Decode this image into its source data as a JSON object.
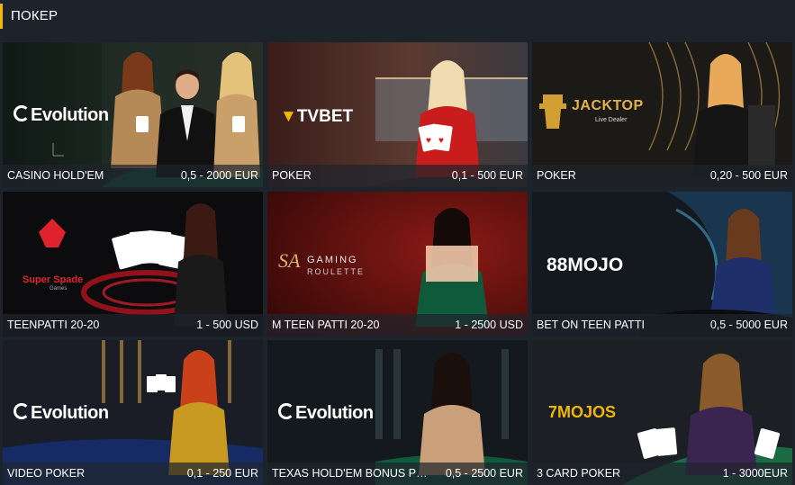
{
  "section": {
    "title": "ПОКЕР"
  },
  "colors": {
    "accent": "#f2b705",
    "background": "#1c232b"
  },
  "cards": [
    {
      "name": "CASINO HOLD'EM",
      "limits": "0,5 - 2000 EUR",
      "provider": "Evolution"
    },
    {
      "name": "POKER",
      "limits": "0,1 - 500 EUR",
      "provider": "TVBET"
    },
    {
      "name": "POKER",
      "limits": "0,20 - 500 EUR",
      "provider": "JACKTOP",
      "provider_sub": "Live Dealer"
    },
    {
      "name": "TEENPATTI 20-20",
      "limits": "1 - 500 USD",
      "provider": "Super Spade",
      "provider_sub": "Games"
    },
    {
      "name": "M TEEN PATTI 20-20",
      "limits": "1 - 2500 USD",
      "provider": "GAMING",
      "provider_sub": "ROULETTE",
      "provider_mark": "SA"
    },
    {
      "name": "BET ON TEEN PATTI",
      "limits": "0,5 - 5000 EUR",
      "provider": "88MOJO"
    },
    {
      "name": "VIDEO POKER",
      "limits": "0,1 - 250 EUR",
      "provider": "Evolution"
    },
    {
      "name": "TEXAS HOLD'EM BONUS POKER",
      "limits": "0,5 - 2500 EUR",
      "provider": "Evolution"
    },
    {
      "name": "3 CARD POKER",
      "limits": "1 - 3000EUR",
      "provider": "7MOJOS"
    }
  ]
}
